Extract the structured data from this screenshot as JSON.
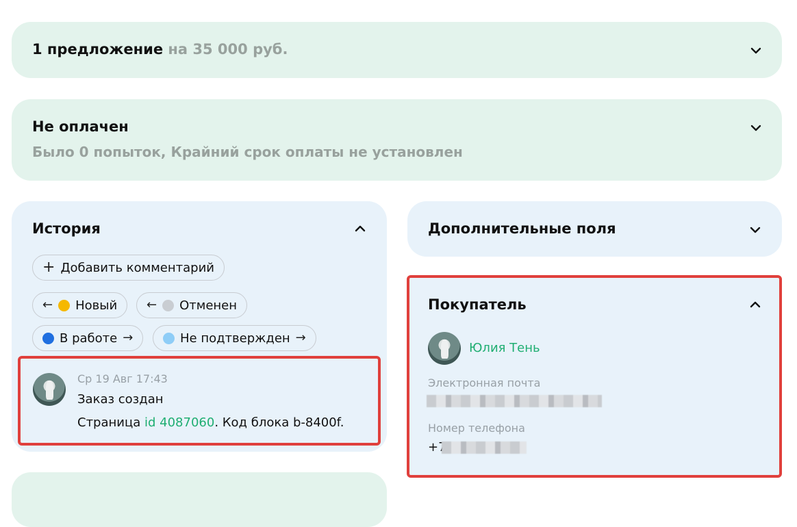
{
  "offer": {
    "count_label": "1 предложение",
    "amount_label": "на 35 000 руб."
  },
  "payment": {
    "status": "Не оплачен",
    "details": "Было 0 попыток, Крайний срок оплаты не установлен"
  },
  "history": {
    "title": "История",
    "add_comment_label": "Добавить комментарий",
    "add_comment_glyph": "+",
    "status_buttons": [
      {
        "label": "Новый",
        "direction": "back",
        "dot_color": "#f5b800"
      },
      {
        "label": "Отменен",
        "direction": "back",
        "dot_color": "#c9cdd2"
      },
      {
        "label": "В работе",
        "direction": "forward",
        "dot_color": "#1f6fe0"
      },
      {
        "label": "Не подтвержден",
        "direction": "forward",
        "dot_color": "#8ecdf7"
      }
    ],
    "arrow_back": "←",
    "arrow_forward": "→",
    "entry": {
      "datetime": "Ср 19 Авг 17:43",
      "title": "Заказ создан",
      "text_prefix": "Страница ",
      "page_link": "id 4087060",
      "text_suffix": ". Код блока b-8400f."
    }
  },
  "extra_fields": {
    "title": "Дополнительные поля"
  },
  "buyer": {
    "title": "Покупатель",
    "name": "Юлия Тень",
    "email_label": "Электронная почта",
    "phone_label": "Номер телефона",
    "phone_prefix": "+7"
  },
  "colors": {
    "green_card": "#e3f3ec",
    "blue_card": "#e8f2fa",
    "link": "#1fae72",
    "highlight": "#e0403c"
  }
}
